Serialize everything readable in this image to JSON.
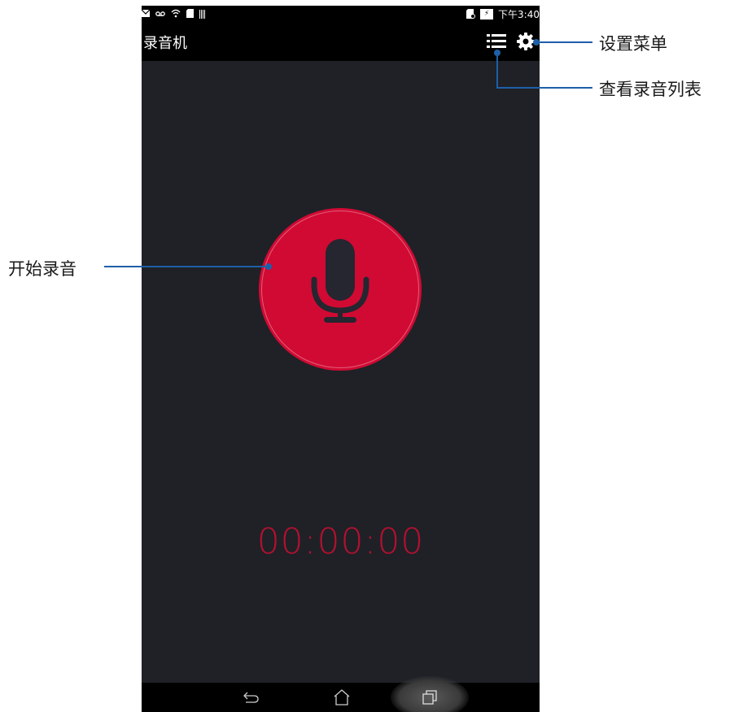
{
  "status_bar": {
    "left_icons": [
      "mail-icon",
      "voicemail-icon",
      "wifi-icon",
      "sd-card-icon",
      "barcode-icon"
    ],
    "right_icons": [
      "sd-card-icon",
      "battery-charging-icon"
    ],
    "time": "下午3:40"
  },
  "action_bar": {
    "title": "录音机",
    "list_icon": "list-icon",
    "settings_icon": "gear-icon"
  },
  "main": {
    "record_button_icon": "microphone-icon",
    "timer": "00:00:00"
  },
  "nav_bar": {
    "icons": [
      "back-icon",
      "home-icon",
      "recent-apps-icon"
    ]
  },
  "annotations": {
    "settings_menu": "设置菜单",
    "view_recordings": "查看录音列表",
    "start_recording": "开始录音"
  },
  "colors": {
    "record_red": "#d10a33",
    "timer_red": "#b5102f",
    "screen_bg": "#1f2127",
    "callout_blue": "#1e5fa8"
  }
}
